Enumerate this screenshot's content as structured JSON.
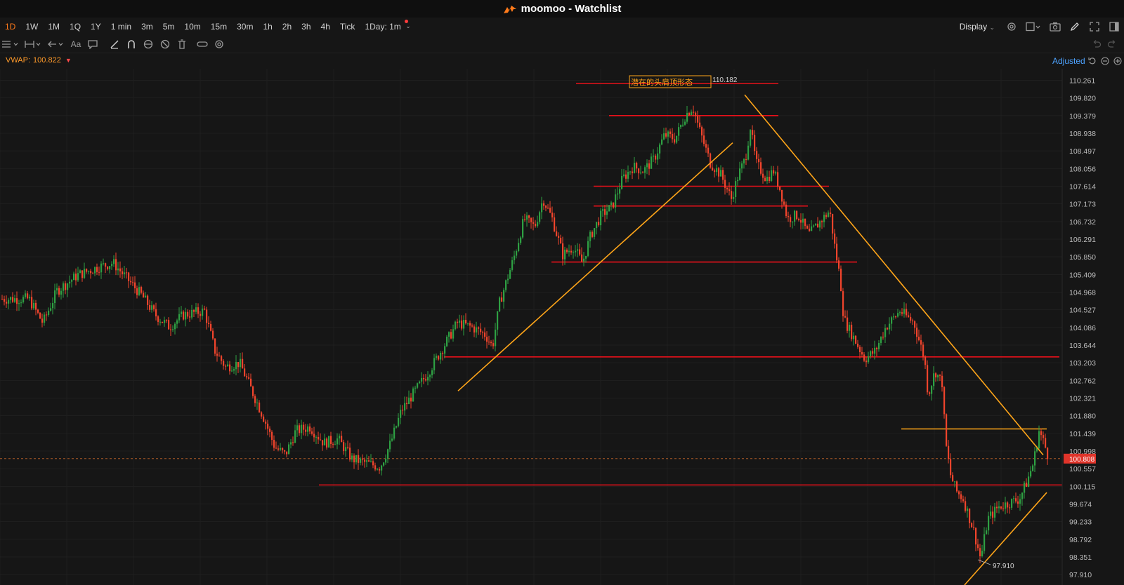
{
  "window": {
    "app": "moomoo",
    "title": "moomoo - Watchlist"
  },
  "timeframes": [
    "1D",
    "1W",
    "1M",
    "1Q",
    "1Y",
    "1 min",
    "3m",
    "5m",
    "10m",
    "15m",
    "30m",
    "1h",
    "2h",
    "3h",
    "4h",
    "Tick"
  ],
  "active_timeframe": "1D",
  "interval_select": "1Day: 1m",
  "display_label": "Display",
  "adjust_label": "Adjusted",
  "vwap": {
    "label": "VWAP:",
    "value": "100.822"
  },
  "colors": {
    "up": "#2ea043",
    "down": "#f0442c",
    "support_line": "#e8101a",
    "trend_line": "#ffa519",
    "accent": "#ff7a1a",
    "price_tag": "#e0342a"
  },
  "annotation": {
    "text": "潜在的头肩顶形态",
    "high_label": "110.182",
    "low_label": "97.910"
  },
  "current_price": "100.808",
  "chart_data": {
    "type": "candlestick",
    "ylim": [
      97.65,
      110.55
    ],
    "y_ticks": [
      "110.261",
      "109.820",
      "109.379",
      "108.938",
      "108.497",
      "108.056",
      "107.614",
      "107.173",
      "106.732",
      "106.291",
      "105.850",
      "105.409",
      "104.968",
      "104.527",
      "104.086",
      "103.644",
      "103.203",
      "102.762",
      "102.321",
      "101.880",
      "101.439",
      "100.998",
      "100.557",
      "100.115",
      "99.674",
      "99.233",
      "98.792",
      "98.351",
      "97.910"
    ],
    "y_tick_values": [
      110.261,
      109.82,
      109.379,
      108.938,
      108.497,
      108.056,
      107.614,
      107.173,
      106.732,
      106.291,
      105.85,
      105.409,
      104.968,
      104.527,
      104.086,
      103.644,
      103.203,
      102.762,
      102.321,
      101.88,
      101.439,
      100.998,
      100.557,
      100.115,
      99.674,
      99.233,
      98.792,
      98.351,
      97.91
    ],
    "current_price_value": 100.808,
    "price_path": [
      [
        0,
        104.8
      ],
      [
        40,
        104.8
      ],
      [
        60,
        104.2
      ],
      [
        80,
        105.0
      ],
      [
        110,
        105.4
      ],
      [
        140,
        105.6
      ],
      [
        160,
        105.7
      ],
      [
        180,
        105.3
      ],
      [
        200,
        104.9
      ],
      [
        220,
        104.4
      ],
      [
        240,
        104.1
      ],
      [
        260,
        104.4
      ],
      [
        290,
        104.5
      ],
      [
        305,
        103.5
      ],
      [
        320,
        103.1
      ],
      [
        340,
        103.2
      ],
      [
        360,
        102.4
      ],
      [
        375,
        101.8
      ],
      [
        390,
        101.1
      ],
      [
        405,
        100.9
      ],
      [
        420,
        101.5
      ],
      [
        440,
        101.6
      ],
      [
        460,
        101.2
      ],
      [
        480,
        101.3
      ],
      [
        500,
        100.8
      ],
      [
        520,
        100.7
      ],
      [
        540,
        100.6
      ],
      [
        555,
        101.2
      ],
      [
        570,
        102.0
      ],
      [
        590,
        102.5
      ],
      [
        610,
        103.0
      ],
      [
        630,
        103.6
      ],
      [
        650,
        104.2
      ],
      [
        670,
        104.1
      ],
      [
        690,
        103.9
      ],
      [
        700,
        103.6
      ],
      [
        710,
        104.7
      ],
      [
        730,
        105.8
      ],
      [
        745,
        106.8
      ],
      [
        760,
        106.6
      ],
      [
        772,
        107.3
      ],
      [
        785,
        106.8
      ],
      [
        800,
        105.9
      ],
      [
        815,
        106.1
      ],
      [
        828,
        105.7
      ],
      [
        840,
        106.4
      ],
      [
        855,
        106.9
      ],
      [
        870,
        107.1
      ],
      [
        885,
        107.8
      ],
      [
        900,
        108.1
      ],
      [
        915,
        108.0
      ],
      [
        930,
        108.3
      ],
      [
        945,
        108.9
      ],
      [
        960,
        108.8
      ],
      [
        975,
        109.4
      ],
      [
        985,
        109.6
      ],
      [
        995,
        109.0
      ],
      [
        1010,
        108.2
      ],
      [
        1025,
        107.9
      ],
      [
        1040,
        107.3
      ],
      [
        1050,
        107.9
      ],
      [
        1060,
        108.3
      ],
      [
        1067,
        109.1
      ],
      [
        1075,
        108.2
      ],
      [
        1090,
        107.8
      ],
      [
        1100,
        108.0
      ],
      [
        1110,
        107.5
      ],
      [
        1120,
        106.8
      ],
      [
        1135,
        106.9
      ],
      [
        1150,
        106.4
      ],
      [
        1165,
        106.7
      ],
      [
        1180,
        107.0
      ],
      [
        1188,
        106.0
      ],
      [
        1195,
        105.3
      ],
      [
        1200,
        104.3
      ],
      [
        1215,
        103.8
      ],
      [
        1230,
        103.3
      ],
      [
        1245,
        103.5
      ],
      [
        1260,
        104.1
      ],
      [
        1280,
        104.5
      ],
      [
        1300,
        104.2
      ],
      [
        1315,
        103.3
      ],
      [
        1320,
        102.4
      ],
      [
        1330,
        103.0
      ],
      [
        1340,
        102.7
      ],
      [
        1345,
        101.2
      ],
      [
        1352,
        100.4
      ],
      [
        1360,
        100.0
      ],
      [
        1370,
        99.8
      ],
      [
        1385,
        99.0
      ],
      [
        1395,
        98.3
      ],
      [
        1405,
        99.3
      ],
      [
        1420,
        99.6
      ],
      [
        1435,
        99.7
      ],
      [
        1450,
        99.8
      ],
      [
        1460,
        100.2
      ],
      [
        1470,
        100.7
      ],
      [
        1478,
        101.5
      ],
      [
        1485,
        101.2
      ],
      [
        1492,
        100.8
      ]
    ],
    "horizontal_lines": [
      {
        "y": 110.182,
        "x0": 820,
        "x1": 1108,
        "color": "support_line"
      },
      {
        "y": 109.379,
        "x0": 867,
        "x1": 1108,
        "color": "support_line"
      },
      {
        "y": 107.614,
        "x0": 845,
        "x1": 1180,
        "color": "support_line"
      },
      {
        "y": 107.12,
        "x0": 845,
        "x1": 1150,
        "color": "support_line"
      },
      {
        "y": 105.72,
        "x0": 785,
        "x1": 1220,
        "color": "support_line"
      },
      {
        "y": 103.35,
        "x0": 632,
        "x1": 1508,
        "color": "support_line"
      },
      {
        "y": 100.15,
        "x0": 454,
        "x1": 1512,
        "color": "support_line"
      },
      {
        "y": 101.55,
        "x0": 1283,
        "x1": 1490,
        "color": "trend_line"
      }
    ],
    "trend_lines": [
      {
        "p0": [
          652,
          102.5
        ],
        "p1": [
          1043,
          108.7
        ]
      },
      {
        "p0": [
          1060,
          109.9
        ],
        "p1": [
          1485,
          100.9
        ]
      },
      {
        "p0": [
          1373,
          97.65
        ],
        "p1": [
          1490,
          99.96
        ]
      }
    ]
  }
}
